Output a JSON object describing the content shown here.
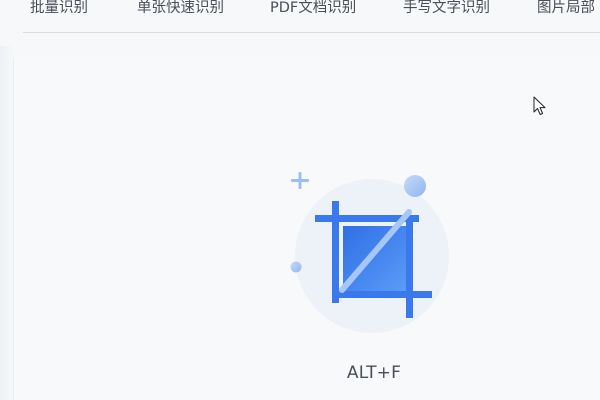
{
  "tabs": [
    {
      "label": "批量识别"
    },
    {
      "label": "单张快速识别"
    },
    {
      "label": "PDF文档识别"
    },
    {
      "label": "手写文字识别"
    },
    {
      "label": "图片局部"
    }
  ],
  "main": {
    "illustration_icon": "crop-icon",
    "shortcut": "ALT+F"
  },
  "colors": {
    "accent_blue": "#3f7ff2",
    "light_blue": "#a8c6f8",
    "circle_bg": "#edf2f9",
    "text": "#4a4f57",
    "page_bg": "#f6f8fa"
  }
}
